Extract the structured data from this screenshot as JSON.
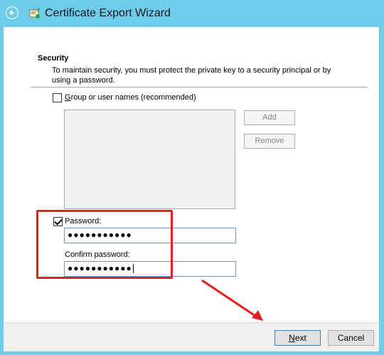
{
  "window": {
    "title": "Certificate Export Wizard",
    "back_icon": "back-arrow-icon",
    "app_icon": "certificate-icon"
  },
  "security": {
    "heading": "Security",
    "description": "To maintain security, you must protect the private key to a security principal or by using a password.",
    "group_checkbox": {
      "label": "Group or user names (recommended)",
      "checked": false
    },
    "add_button": "Add",
    "remove_button": "Remove",
    "password_checkbox": {
      "label": "Password:",
      "checked": true
    },
    "password_value": "●●●●●●●●●●●",
    "confirm_label": "Confirm password:",
    "confirm_value": "●●●●●●●●●●●"
  },
  "footer": {
    "next_button": "Next",
    "cancel_button": "Cancel"
  },
  "annotation": {
    "highlight_color": "#e21e25"
  },
  "colors": {
    "titlebar": "#6ecbe9"
  }
}
